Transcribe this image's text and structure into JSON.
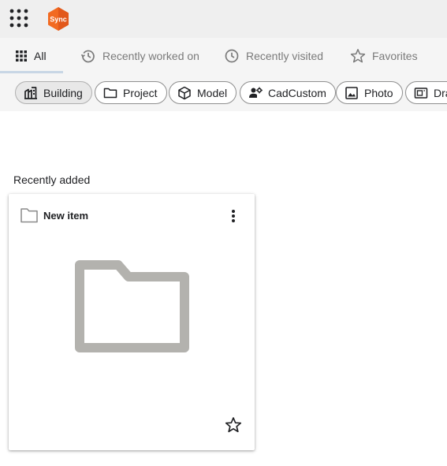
{
  "app": {
    "logo_text": "Sync",
    "brand_colors": {
      "logo_orange": "#f26a21",
      "logo_dark_orange": "#d4511a"
    }
  },
  "tabs": [
    {
      "label": "All",
      "icon": "grid-icon",
      "active": true
    },
    {
      "label": "Recently worked on",
      "icon": "history-icon",
      "active": false
    },
    {
      "label": "Recently visited",
      "icon": "clock-icon",
      "active": false
    },
    {
      "label": "Favorites",
      "icon": "star-icon",
      "active": false
    }
  ],
  "filters": [
    {
      "label": "Building",
      "icon": "building-icon",
      "selected": true
    },
    {
      "label": "Project",
      "icon": "folder-icon",
      "selected": false
    },
    {
      "label": "Model",
      "icon": "cube-icon",
      "selected": false
    },
    {
      "label": "CadCustom",
      "icon": "person-gear-icon",
      "selected": false
    },
    {
      "label": "Photo",
      "icon": "image-icon",
      "selected": false
    },
    {
      "label": "Dra",
      "icon": "drawing-icon",
      "selected": false
    }
  ],
  "main": {
    "section_title": "Recently added",
    "items": [
      {
        "title": "New item",
        "icon": "folder-icon",
        "favorite": false
      }
    ]
  }
}
